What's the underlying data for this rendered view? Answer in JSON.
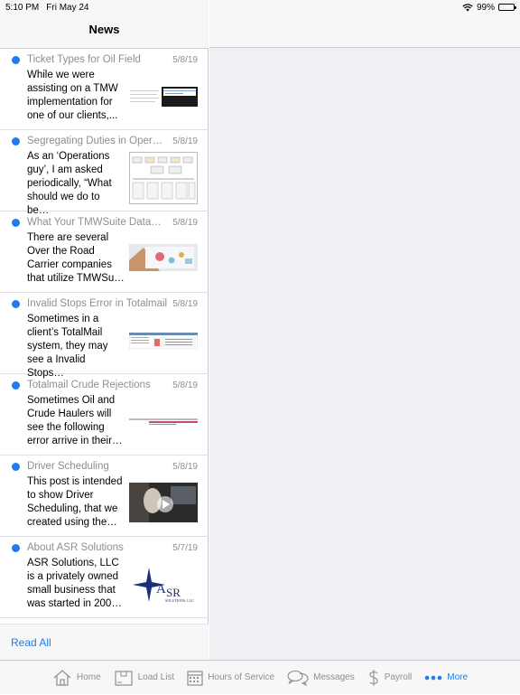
{
  "status": {
    "time": "5:10 PM",
    "date": "Fri May 24",
    "battery": "99%",
    "battery_level": 0.99
  },
  "nav": {
    "title": "News"
  },
  "news": [
    {
      "title": "Ticket Types for Oil Field",
      "date": "5/8/19",
      "excerpt": "While we were assisting on a TMW implementation for one of our clients,..."
    },
    {
      "title": "Segregating Duties in Opera…",
      "date": "5/8/19",
      "excerpt": "As an ‘Operations guy’, I am asked periodically, “What should we do to be…"
    },
    {
      "title": "What Your TMWSuite Data…",
      "date": "5/8/19",
      "excerpt": "There are several Over the Road Carrier companies that utilize TMWSu…"
    },
    {
      "title": "Invalid Stops Error in Totalmail",
      "date": "5/8/19",
      "excerpt": "Sometimes in a client’s TotalMail system, they may see a Invalid Stops…"
    },
    {
      "title": "Totalmail Crude Rejections",
      "date": "5/8/19",
      "excerpt": "Sometimes Oil and Crude Haulers will see the following error arrive in their…"
    },
    {
      "title": "Driver Scheduling",
      "date": "5/8/19",
      "excerpt": "This post is intended to show Driver Scheduling, that we created using the…"
    },
    {
      "title": "About ASR Solutions",
      "date": "5/7/19",
      "excerpt": "ASR Solutions, LLC is a privately owned small business that was started in 200…"
    }
  ],
  "logo": {
    "text_a": "A",
    "text_sr": "SR",
    "text_sub": "SOLUTIONS, LLC"
  },
  "read_all": "Read All",
  "tabs": [
    {
      "label": "Home",
      "icon": "home-icon"
    },
    {
      "label": "Load List",
      "icon": "box-icon"
    },
    {
      "label": "Hours of Service",
      "icon": "calendar-icon"
    },
    {
      "label": "Messages",
      "icon": "chat-bubbles-icon"
    },
    {
      "label": "Payroll",
      "icon": "dollar-icon"
    },
    {
      "label": "More",
      "icon": "more-dots-icon"
    }
  ],
  "colors": {
    "accent": "#1e7cf0",
    "unread_dot": "#1e7cf0",
    "secondary_text": "#8e8e93"
  }
}
